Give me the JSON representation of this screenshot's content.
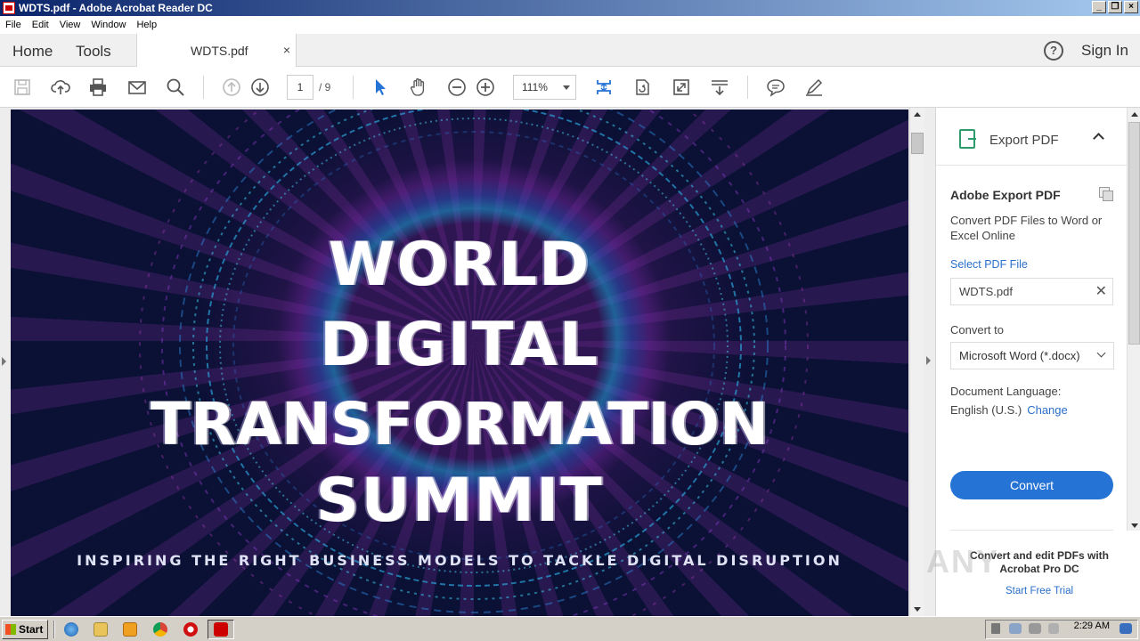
{
  "window": {
    "title": "WDTS.pdf - Adobe Acrobat Reader DC"
  },
  "menu": [
    "File",
    "Edit",
    "View",
    "Window",
    "Help"
  ],
  "tabs": {
    "home": "Home",
    "tools": "Tools",
    "document": "WDTS.pdf"
  },
  "header": {
    "sign_in": "Sign In",
    "help": "?"
  },
  "toolbar": {
    "current_page": "1",
    "page_total": "/ 9",
    "zoom": "111%"
  },
  "document": {
    "title_lines": [
      "WORLD",
      "DIGITAL",
      "TRANSFORMATION",
      "SUMMIT"
    ],
    "tagline": "INSPIRING THE RIGHT BUSINESS MODELS TO TACKLE DIGITAL DISRUPTION"
  },
  "panel": {
    "title": "Export PDF",
    "heading": "Adobe Export PDF",
    "description": "Convert PDF Files to Word or Excel Online",
    "select_file_label": "Select PDF File",
    "file_name": "WDTS.pdf",
    "convert_to_label": "Convert to",
    "convert_to_value": "Microsoft Word (*.docx)",
    "language_label": "Document Language:",
    "language_value": "English (U.S.)",
    "change_link": "Change",
    "convert_button": "Convert",
    "promo_text": "Convert and edit PDFs with Acrobat Pro DC",
    "promo_link": "Start Free Trial"
  },
  "watermark": "ANY",
  "taskbar": {
    "start": "Start",
    "clock": "2:29 AM"
  },
  "colors": {
    "accent": "#2473d5",
    "link": "#2a6fc9",
    "export_green": "#2d9c6a",
    "title_bar": "#0a246a"
  }
}
